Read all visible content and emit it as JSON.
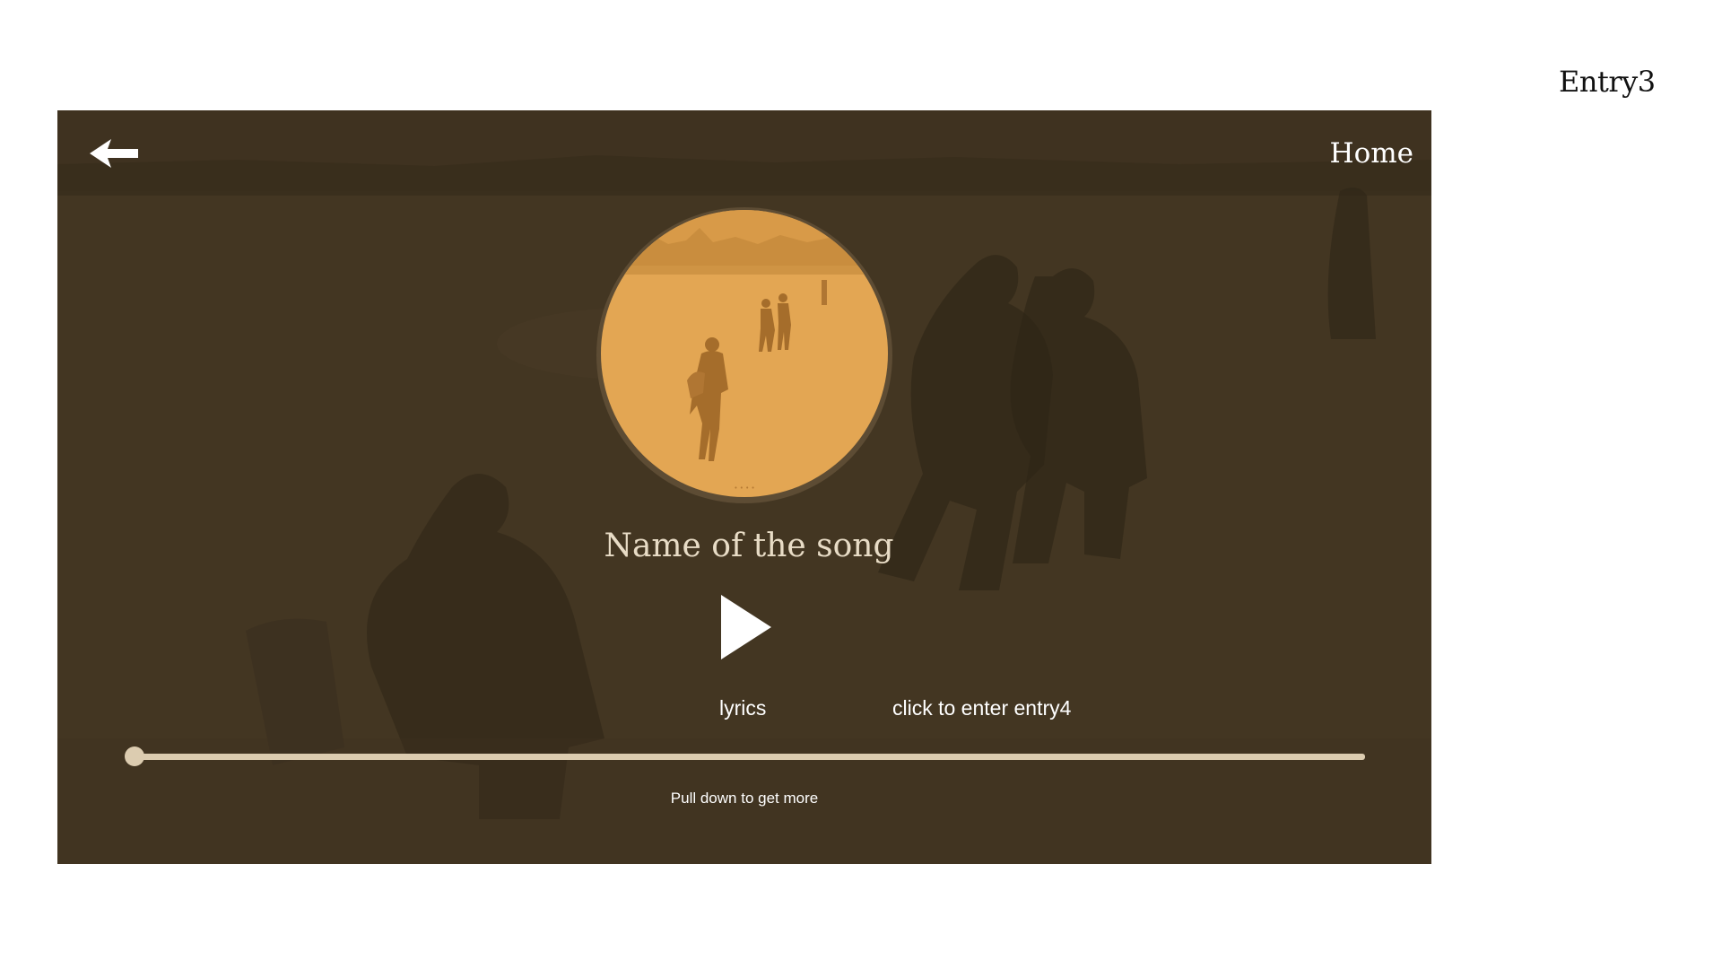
{
  "page": {
    "entry_label": "Entry3"
  },
  "player": {
    "home_label": "Home",
    "back_icon": "arrow-left-icon",
    "cover_icon": "album-cover",
    "song_title": "Name of the song",
    "play_icon": "play-icon",
    "lyrics_label": "lyrics",
    "next_entry_label": "click to enter entry4",
    "progress": 0,
    "pull_hint": "Pull down to get more"
  },
  "colors": {
    "frame_background": "#433622",
    "cover": "#e3a653",
    "track": "#dcccb0",
    "text": "#ffffff"
  }
}
